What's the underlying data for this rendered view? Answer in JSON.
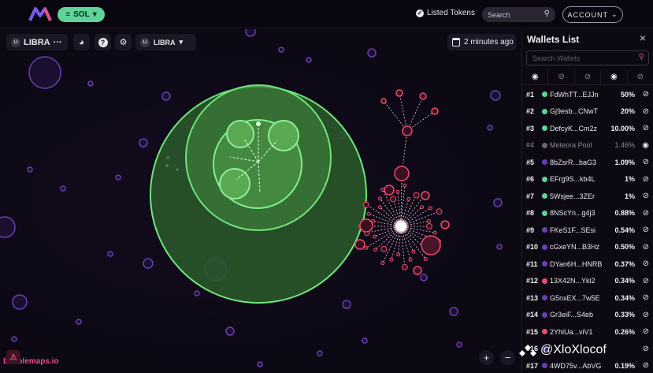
{
  "header": {
    "chain_label": "SOL",
    "listed_tokens_label": "Listed Tokens",
    "search_placeholder": "Search",
    "account_label": "ACCOUNT"
  },
  "toolbar": {
    "token_badge": "LI",
    "token_name": "LIBRA",
    "token_menu": "···",
    "selector_badge": "LI",
    "selector_label": "LIBRA",
    "time_label": "2 minutes ago"
  },
  "footer": {
    "brand": "bubblemaps.io",
    "watermark": "@XloXlocof",
    "zoom_in": "+",
    "zoom_out": "−"
  },
  "panel": {
    "title": "Wallets List",
    "search_placeholder": "Search Wallets",
    "wallets": [
      {
        "rank": "#1",
        "addr": "FdWhTT...EJJn",
        "pct": "50%",
        "color": "#5fd39a",
        "eye": "hidden"
      },
      {
        "rank": "#2",
        "addr": "Gj9esb...CNwT",
        "pct": "20%",
        "color": "#5fd39a",
        "eye": "hidden"
      },
      {
        "rank": "#3",
        "addr": "DefcyK...Cm2z",
        "pct": "10.00%",
        "color": "#5fd39a",
        "eye": "hidden"
      },
      {
        "rank": "#4",
        "addr": "Meteora Pool",
        "pct": "1.46%",
        "color": "#6b6577",
        "eye": "visible",
        "dim": true
      },
      {
        "rank": "#5",
        "addr": "8bZsrR...baG3",
        "pct": "1.09%",
        "color": "#6a3fb5",
        "eye": "hidden"
      },
      {
        "rank": "#6",
        "addr": "EFrg9S...kb4L",
        "pct": "1%",
        "color": "#5fd39a",
        "eye": "hidden"
      },
      {
        "rank": "#7",
        "addr": "5Wsjee...3ZEr",
        "pct": "1%",
        "color": "#5fd39a",
        "eye": "hidden"
      },
      {
        "rank": "#8",
        "addr": "8NScYn...g4j3",
        "pct": "0.88%",
        "color": "#5fd39a",
        "eye": "hidden"
      },
      {
        "rank": "#9",
        "addr": "FKeS1F...SEsi",
        "pct": "0.54%",
        "color": "#6a3fb5",
        "eye": "hidden"
      },
      {
        "rank": "#10",
        "addr": "cGxeYN...B3Hz",
        "pct": "0.50%",
        "color": "#6a3fb5",
        "eye": "hidden"
      },
      {
        "rank": "#11",
        "addr": "DYan6H...HNRB",
        "pct": "0.37%",
        "color": "#6a3fb5",
        "eye": "hidden"
      },
      {
        "rank": "#12",
        "addr": "13X42N...Yki2",
        "pct": "0.34%",
        "color": "#e94d6e",
        "eye": "hidden"
      },
      {
        "rank": "#13",
        "addr": "G5nxEX...7w5E",
        "pct": "0.34%",
        "color": "#6a3fb5",
        "eye": "hidden"
      },
      {
        "rank": "#14",
        "addr": "Gr3eiF...S4eb",
        "pct": "0.33%",
        "color": "#6a3fb5",
        "eye": "hidden"
      },
      {
        "rank": "#15",
        "addr": "2YhiUa...viV1",
        "pct": "0.26%",
        "color": "#e94d6e",
        "eye": "hidden"
      },
      {
        "rank": "#16",
        "addr": "",
        "pct": "",
        "color": "#6a3fb5",
        "eye": "hidden"
      },
      {
        "rank": "#17",
        "addr": "4WD75v...AbVG",
        "pct": "0.19%",
        "color": "#6a3fb5",
        "eye": "hidden"
      }
    ]
  },
  "colors": {
    "accent_green": "#5fd39a",
    "accent_pink": "#e94d6e",
    "bubble_purple": "#6a3fb5",
    "background": "#0b0712"
  }
}
